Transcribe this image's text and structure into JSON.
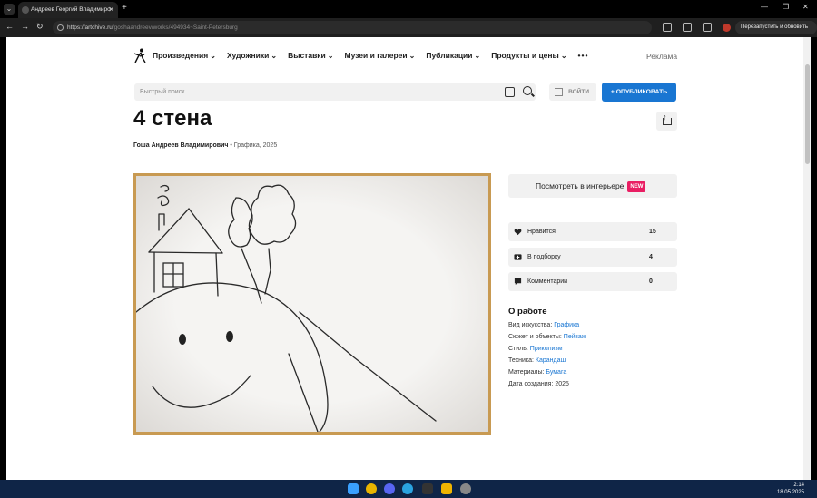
{
  "browser": {
    "tab_title": "Андреев Георгий Владимиро",
    "url_host": "https://artchive.ru",
    "url_path": "/goshaandreev/works/494934~Saint-Petersburg",
    "relaunch_label": "Перезапустить и обновить"
  },
  "site": {
    "nav": [
      "Произведения",
      "Художники",
      "Выставки",
      "Музеи и галереи",
      "Публикации",
      "Продукты и цены"
    ],
    "nav_more": "•••",
    "ad_label": "Реклама",
    "search_placeholder": "Быстрый поиск",
    "login_label": "ВОЙТИ",
    "publish_label": "+ ОПУБЛИКОВАТЬ"
  },
  "artwork": {
    "title": "4 стена",
    "author": "Гоша Андреев Владимирович",
    "meta": " • Графика, 2025",
    "view_in_interior": "Посмотреть в интерьере",
    "new_badge": "NEW"
  },
  "stats": [
    {
      "label": "Нравится",
      "value": "15",
      "icon": "heart-icon"
    },
    {
      "label": "В подборку",
      "value": "4",
      "icon": "collection-icon"
    },
    {
      "label": "Комментарии",
      "value": "0",
      "icon": "comment-icon"
    }
  ],
  "about": {
    "heading": "О работе",
    "props": [
      {
        "label": "Вид искусства: ",
        "value": "Графика"
      },
      {
        "label": "Сюжет и объекты: ",
        "value": "Пейзаж"
      },
      {
        "label": "Стиль: ",
        "value": "Приколизм"
      },
      {
        "label": "Техника: ",
        "value": "Карандаш"
      },
      {
        "label": "Материалы: ",
        "value": "Бумага"
      },
      {
        "label": "Дата создания: ",
        "value": "2025"
      }
    ]
  },
  "taskbar": {
    "time": "2:14",
    "date": "18.05.2025"
  },
  "colors": {
    "accent": "#1976d2",
    "new_badge": "#e91e63",
    "frame": "#c89a52"
  }
}
